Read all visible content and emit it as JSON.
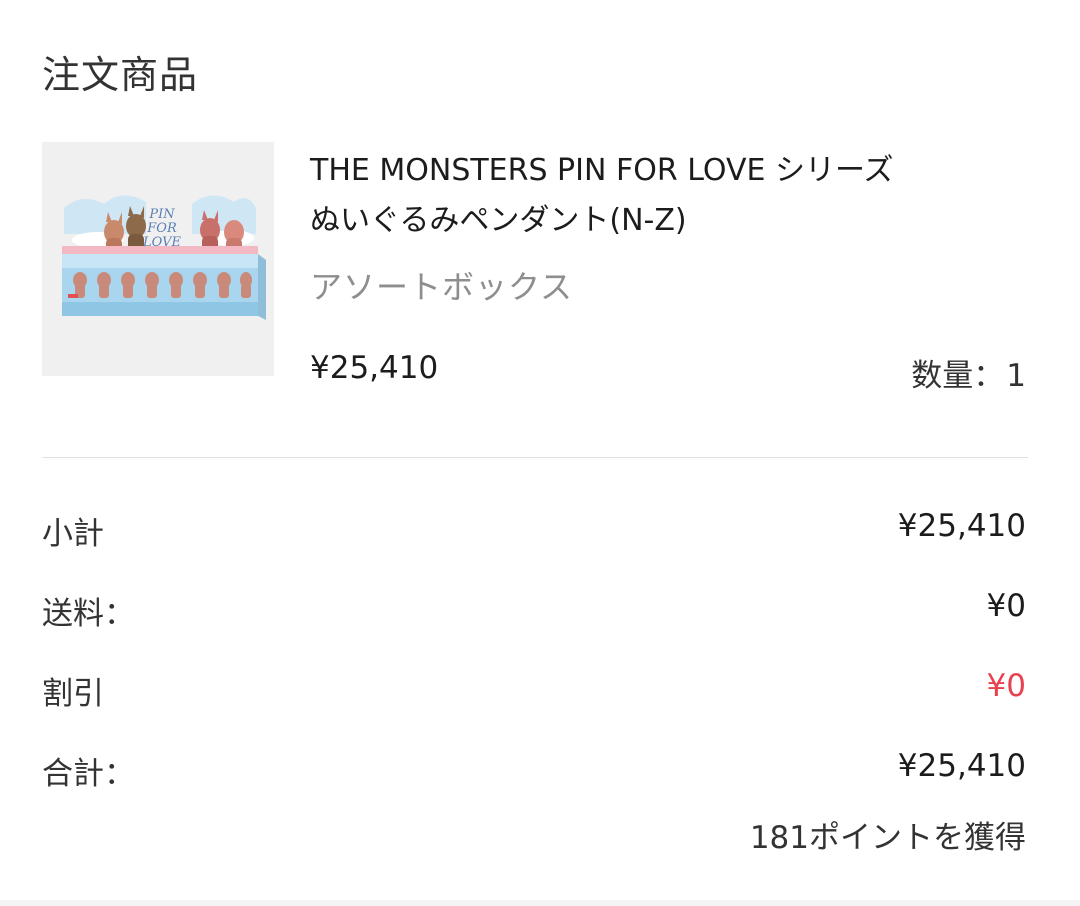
{
  "section": {
    "title": "注文商品"
  },
  "product": {
    "name_line1": "THE MONSTERS PIN FOR LOVE シリーズ",
    "name_line2": "ぬいぐるみペンダント(N-Z)",
    "variant": "アソートボックス",
    "price": "¥25,410",
    "quantity_label": "数量：",
    "quantity_value": "1",
    "image_label": "PIN FOR LOVE"
  },
  "summary": {
    "subtotal_label": "小計",
    "subtotal_value": "¥25,410",
    "shipping_label": "送料：",
    "shipping_value": "¥0",
    "discount_label": "割引",
    "discount_value": "¥0",
    "total_label": "合計：",
    "total_value": "¥25,410",
    "points_text": "181ポイントを獲得"
  },
  "colors": {
    "discount_red": "#e8414f",
    "variant_gray": "#8e8e8e",
    "image_bg": "#f0f0f0",
    "box_blue": "#a9d6ee"
  }
}
